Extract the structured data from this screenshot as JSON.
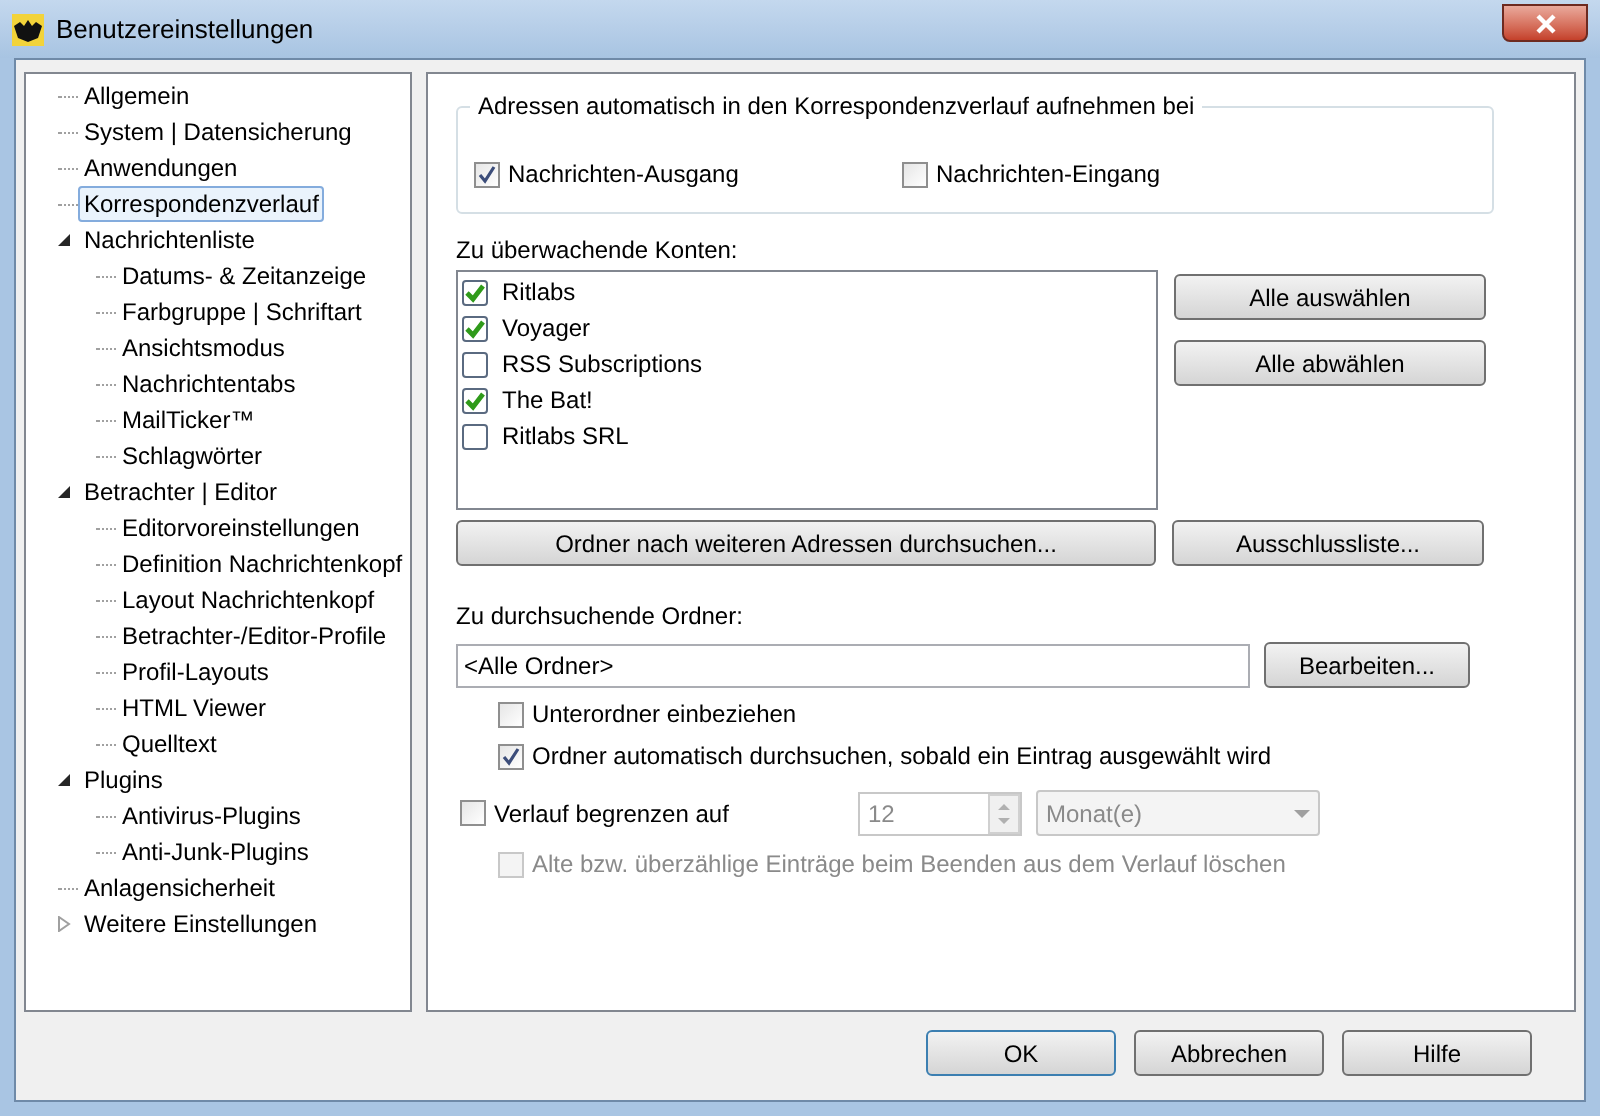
{
  "window": {
    "title": "Benutzereinstellungen"
  },
  "tree": [
    {
      "label": "Allgemein",
      "selected": false
    },
    {
      "label": "System | Datensicherung",
      "selected": false
    },
    {
      "label": "Anwendungen",
      "selected": false
    },
    {
      "label": "Korrespondenzverlauf",
      "selected": true
    },
    {
      "label": "Nachrichtenliste",
      "selected": false,
      "expanded": true,
      "children": [
        {
          "label": "Datums- & Zeitanzeige",
          "selected": false
        },
        {
          "label": "Farbgruppe | Schriftart",
          "selected": false
        },
        {
          "label": "Ansichtsmodus",
          "selected": false
        },
        {
          "label": "Nachrichtentabs",
          "selected": false
        },
        {
          "label": "MailTicker™",
          "selected": false
        },
        {
          "label": "Schlagwörter",
          "selected": false
        }
      ]
    },
    {
      "label": "Betrachter | Editor",
      "selected": false,
      "expanded": true,
      "children": [
        {
          "label": "Editorvoreinstellungen",
          "selected": false
        },
        {
          "label": "Definition Nachrichtenkopf",
          "selected": false
        },
        {
          "label": "Layout Nachrichtenkopf",
          "selected": false
        },
        {
          "label": "Betrachter-/Editor-Profile",
          "selected": false
        },
        {
          "label": "Profil-Layouts",
          "selected": false
        },
        {
          "label": "HTML Viewer",
          "selected": false
        },
        {
          "label": "Quelltext",
          "selected": false
        }
      ]
    },
    {
      "label": "Plugins",
      "selected": false,
      "expanded": true,
      "children": [
        {
          "label": "Antivirus-Plugins",
          "selected": false
        },
        {
          "label": "Anti-Junk-Plugins",
          "selected": false
        }
      ]
    },
    {
      "label": "Anlagensicherheit",
      "selected": false
    },
    {
      "label": "Weitere Einstellungen",
      "selected": false,
      "expanded": false
    }
  ],
  "auto_group": {
    "legend": "Adressen automatisch in den Korrespondenzverlauf aufnehmen bei",
    "options": [
      {
        "label": "Nachrichten-Ausgang",
        "checked": true
      },
      {
        "label": "Nachrichten-Eingang",
        "checked": false
      }
    ]
  },
  "accounts": {
    "label": "Zu überwachende Konten:",
    "items": [
      {
        "label": "Ritlabs",
        "checked": true
      },
      {
        "label": "Voyager",
        "checked": true
      },
      {
        "label": "RSS Subscriptions",
        "checked": false
      },
      {
        "label": "The Bat!",
        "checked": true
      },
      {
        "label": "Ritlabs SRL",
        "checked": false
      }
    ],
    "side_buttons": [
      "Alle auswählen",
      "Alle abwählen"
    ],
    "scan_button": "Ordner nach weiteren Adressen durchsuchen...",
    "exclude_button": "Ausschlussliste..."
  },
  "folders": {
    "label": "Zu durchsuchende Ordner:",
    "value": "<Alle Ordner>",
    "edit_button": "Bearbeiten...",
    "options": [
      {
        "label": "Unterordner einbeziehen",
        "checked": false
      },
      {
        "label": "Ordner automatisch durchsuchen, sobald ein Eintrag ausgewählt wird",
        "checked": true
      }
    ]
  },
  "limit": {
    "label": "Verlauf begrenzen auf",
    "checked": false,
    "amount": "12",
    "unit": "Monat(e)",
    "disabled": true,
    "cleanup": {
      "label": "Alte bzw. überzählige Einträge beim Beenden aus dem Verlauf löschen",
      "checked": false,
      "disabled": true
    }
  },
  "buttons": [
    "OK",
    "Abbrechen",
    "Hilfe"
  ]
}
